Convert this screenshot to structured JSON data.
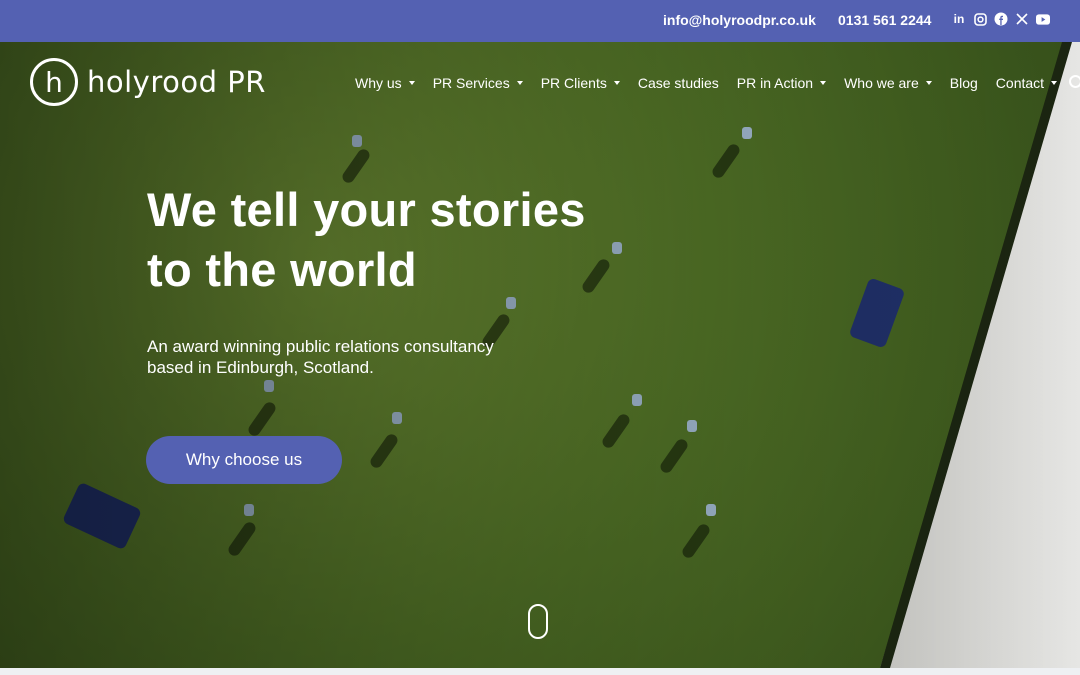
{
  "topbar": {
    "email": "info@holyroodpr.co.uk",
    "phone": "0131 561 2244",
    "social_icons": [
      "linkedin-icon",
      "instagram-icon",
      "facebook-icon",
      "x-icon",
      "youtube-icon"
    ]
  },
  "brand": {
    "logo_mark": "h",
    "name": "holyrood PR"
  },
  "nav": {
    "items": [
      {
        "label": "Why us",
        "dropdown": true
      },
      {
        "label": "PR Services",
        "dropdown": true
      },
      {
        "label": "PR Clients",
        "dropdown": true
      },
      {
        "label": "Case studies",
        "dropdown": false
      },
      {
        "label": "PR in Action",
        "dropdown": true
      },
      {
        "label": "Who we are",
        "dropdown": true
      },
      {
        "label": "Blog",
        "dropdown": false
      },
      {
        "label": "Contact",
        "dropdown": true
      }
    ],
    "search_icon": "search-icon"
  },
  "hero": {
    "headline_line1": "We tell your stories",
    "headline_line2": "to the world",
    "subtitle_line1": "An award winning public relations consultancy",
    "subtitle_line2": "based in Edinburgh, Scotland.",
    "cta_label": "Why choose us",
    "scroll_icon": "scroll-mouse-icon"
  },
  "colors": {
    "accent": "#5461b2",
    "text": "#ffffff"
  }
}
